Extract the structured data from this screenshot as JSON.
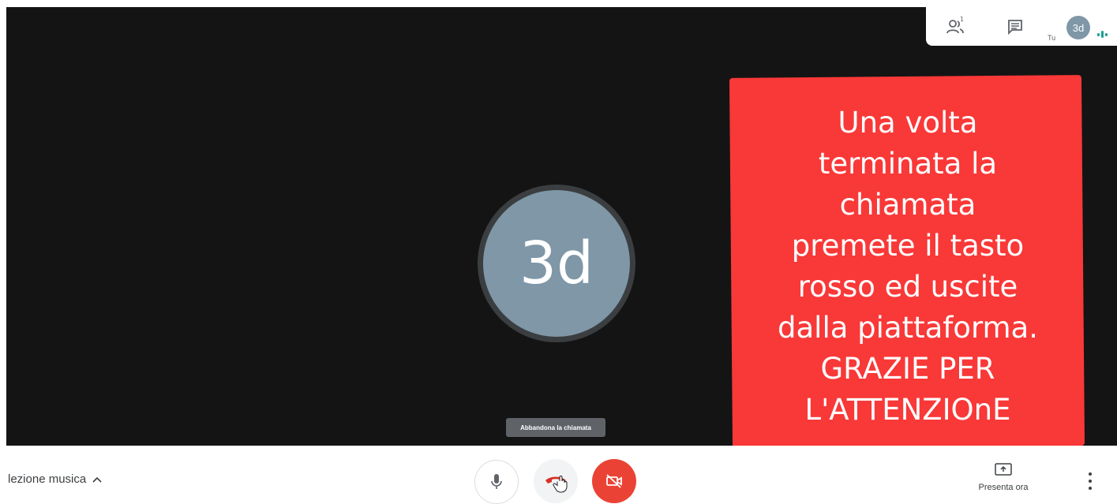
{
  "stage": {
    "avatar_initials": "3d"
  },
  "top_panel": {
    "participants_count": "1",
    "self_label": "Tu",
    "self_initials": "3d"
  },
  "overlay_note": {
    "text": "Una volta\nterminata la\nchiamata\npremete il tasto\nrosso ed uscite\ndalla piattaforma.\nGRAZIE PER\nL'ATTENZIOnE",
    "color": "#f93838"
  },
  "tooltip": {
    "text": "Abbandona la chiamata"
  },
  "bottom_bar": {
    "meeting_name": "lezione musica",
    "present_label": "Presenta ora",
    "hangup_color": "#d93025",
    "camera_off_color": "#ea4335",
    "icons": {
      "mic": "mic-icon",
      "hangup": "phone-hangup-icon",
      "camera": "camera-off-icon",
      "present": "present-screen-icon",
      "more": "more-vert-icon",
      "chevron": "chevron-up-icon"
    }
  }
}
